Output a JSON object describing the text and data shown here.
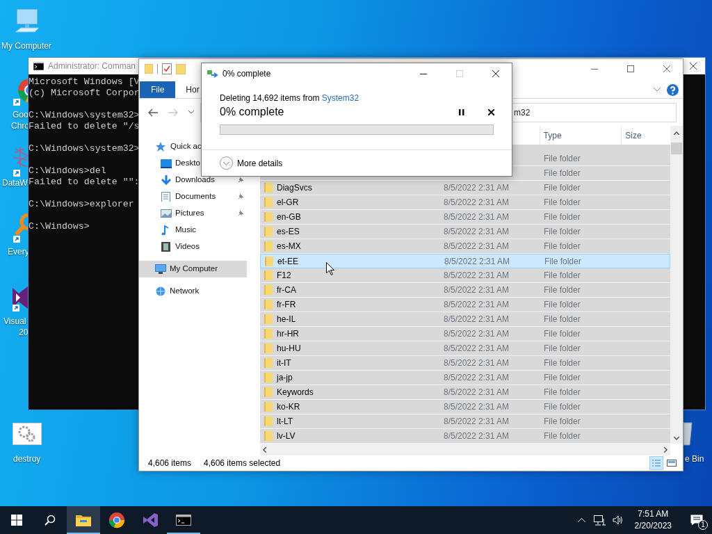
{
  "desktop_icons": [
    {
      "kind": "computer",
      "label": [
        "My Computer"
      ]
    },
    {
      "kind": "chrome",
      "label": [
        "Goo",
        "Chro"
      ]
    },
    {
      "kind": "data",
      "label": [
        "DataW"
      ]
    },
    {
      "kind": "everything",
      "label": [
        "Every"
      ]
    },
    {
      "kind": "vs",
      "label": [
        "Visual",
        "20"
      ]
    },
    {
      "kind": "gears",
      "label": [
        "destroy"
      ]
    },
    {
      "kind": "bin",
      "label": [
        "e Bin"
      ]
    }
  ],
  "console": {
    "title": "Administrator: Comman",
    "blocks": [
      [
        "Microsoft Windows [V",
        "(c) Microsoft Corpor"
      ],
      [
        "C:\\Windows\\system32>",
        "Failed to delete \"/s"
      ],
      [
        "C:\\Windows\\system32>"
      ],
      [
        "C:\\Windows>del",
        "Failed to delete \"\":"
      ],
      [
        "C:\\Windows>explorer"
      ],
      [
        "C:\\Windows>"
      ]
    ]
  },
  "explorer": {
    "ribbon_tabs": [
      {
        "label": "File",
        "selected": true
      },
      {
        "label": "Hor",
        "selected": false
      }
    ],
    "address": "m32",
    "nav": [
      {
        "label": "Quick ac",
        "kind": "star",
        "selected": false,
        "children": [
          {
            "label": "Deskto",
            "kind": "desktop",
            "selected": false,
            "pinned": false
          },
          {
            "label": "Downloads",
            "kind": "download",
            "selected": false,
            "pinned": true
          },
          {
            "label": "Documents",
            "kind": "document",
            "selected": false,
            "pinned": true
          },
          {
            "label": "Pictures",
            "kind": "pictures",
            "selected": false,
            "pinned": true
          },
          {
            "label": "Music",
            "kind": "music",
            "selected": false,
            "pinned": false
          },
          {
            "label": "Videos",
            "kind": "videos",
            "selected": false,
            "pinned": false
          }
        ]
      },
      {
        "label": "My Computer",
        "kind": "computer",
        "selected": true
      },
      {
        "label": "Network",
        "kind": "network",
        "selected": false
      }
    ],
    "columns": [
      "Type",
      "Size"
    ],
    "rows": [
      {
        "type": "File folder",
        "selected": true,
        "hot": false
      },
      {
        "type": "File folder",
        "selected": true,
        "hot": false
      },
      {
        "name": "DiagSvcs",
        "date": "8/5/2022 2:31 AM",
        "type": "File folder",
        "selected": true,
        "hot": false
      },
      {
        "name": "el-GR",
        "date": "8/5/2022 2:31 AM",
        "type": "File folder",
        "selected": true,
        "hot": false
      },
      {
        "name": "en-GB",
        "date": "8/5/2022 2:31 AM",
        "type": "File folder",
        "selected": true,
        "hot": false
      },
      {
        "name": "es-ES",
        "date": "8/5/2022 2:31 AM",
        "type": "File folder",
        "selected": true,
        "hot": false
      },
      {
        "name": "es-MX",
        "date": "8/5/2022 2:31 AM",
        "type": "File folder",
        "selected": true,
        "hot": false
      },
      {
        "name": "et-EE",
        "date": "8/5/2022 2:31 AM",
        "type": "File folder",
        "selected": true,
        "hot": true
      },
      {
        "name": "F12",
        "date": "8/5/2022 2:31 AM",
        "type": "File folder",
        "selected": true,
        "hot": false
      },
      {
        "name": "fr-CA",
        "date": "8/5/2022 2:31 AM",
        "type": "File folder",
        "selected": true,
        "hot": false
      },
      {
        "name": "fr-FR",
        "date": "8/5/2022 2:31 AM",
        "type": "File folder",
        "selected": true,
        "hot": false
      },
      {
        "name": "he-IL",
        "date": "8/5/2022 2:31 AM",
        "type": "File folder",
        "selected": true,
        "hot": false
      },
      {
        "name": "hr-HR",
        "date": "8/5/2022 2:31 AM",
        "type": "File folder",
        "selected": true,
        "hot": false
      },
      {
        "name": "hu-HU",
        "date": "8/5/2022 2:31 AM",
        "type": "File folder",
        "selected": true,
        "hot": false
      },
      {
        "name": "it-IT",
        "date": "8/5/2022 2:31 AM",
        "type": "File folder",
        "selected": true,
        "hot": false
      },
      {
        "name": "ja-jp",
        "date": "8/5/2022 2:31 AM",
        "type": "File folder",
        "selected": true,
        "hot": false
      },
      {
        "name": "Keywords",
        "date": "8/5/2022 2:31 AM",
        "type": "File folder",
        "selected": true,
        "hot": false
      },
      {
        "name": "ko-KR",
        "date": "8/5/2022 2:31 AM",
        "type": "File folder",
        "selected": true,
        "hot": false
      },
      {
        "name": "lt-LT",
        "date": "8/5/2022 2:31 AM",
        "type": "File folder",
        "selected": true,
        "hot": false
      },
      {
        "name": "lv-LV",
        "date": "8/5/2022 2:31 AM",
        "type": "File folder",
        "selected": true,
        "hot": false
      }
    ],
    "status": {
      "count": "4,606 items",
      "selection": "4,606 items selected"
    },
    "views": [
      {
        "kind": "details",
        "selected": true
      },
      {
        "kind": "tiles",
        "selected": false
      }
    ]
  },
  "dialog": {
    "title": "0% complete",
    "message": "Deleting 14,692 items from ",
    "source": "System32",
    "progress_label": "0% complete",
    "level": 0,
    "maximize_disabled": true,
    "details_label": "More details"
  },
  "taskbar": {
    "pinned_apps": [
      {
        "kind": "explorer",
        "running": true,
        "active": true
      },
      {
        "kind": "chrome",
        "running": false,
        "active": false
      },
      {
        "kind": "vs",
        "running": false,
        "active": false
      },
      {
        "kind": "console",
        "running": true,
        "active": false
      }
    ],
    "time": "7:51 AM",
    "date": "2/20/2023",
    "notification_count": "1"
  }
}
